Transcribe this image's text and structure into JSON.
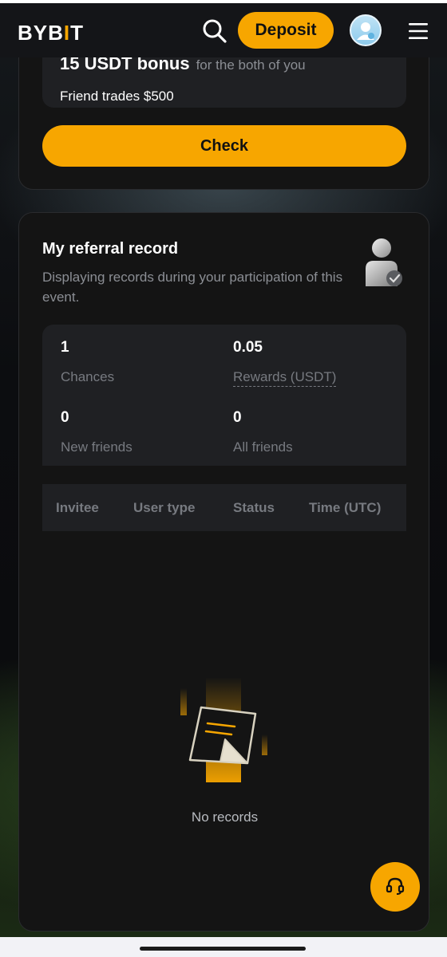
{
  "header": {
    "logo_main": "BYB",
    "logo_bar": "I",
    "logo_end": "T",
    "deposit_label": "Deposit",
    "icons": {
      "search": "search-icon",
      "avatar": "user-avatar-icon",
      "menu": "hamburger-menu-icon"
    }
  },
  "reward_card": {
    "bonus_text": "15 USDT bonus",
    "bonus_sub": "for the both of you",
    "friend_trades": "Friend trades $500",
    "check_label": "Check"
  },
  "referral": {
    "title": "My referral record",
    "description": "Displaying records during your participation of this event.",
    "stats": [
      {
        "value": "1",
        "label": "Chances"
      },
      {
        "value": "0.05",
        "label": "Rewards (USDT)"
      },
      {
        "value": "0",
        "label": "New friends"
      },
      {
        "value": "0",
        "label": "All friends"
      }
    ],
    "table_headers": [
      "Invitee",
      "User type",
      "Status",
      "Time (UTC)"
    ],
    "empty_text": "No records"
  },
  "colors": {
    "accent": "#f7a600",
    "card_bg": "#141414",
    "inner_bg": "#1f2023",
    "muted_text": "#8b8e94"
  }
}
